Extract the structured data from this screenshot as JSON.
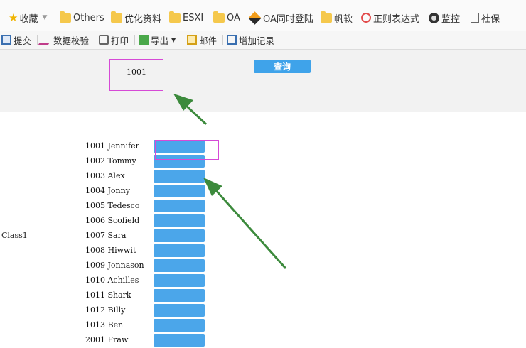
{
  "bookmarks": {
    "favorites": "收藏",
    "items": [
      "Others",
      "优化资料",
      "ESXI",
      "OA",
      "OA同时登陆",
      "帆软",
      "正则表达式",
      "监控",
      "社保"
    ]
  },
  "toolbar": {
    "submit": "提交",
    "validate": "数据校验",
    "print": "打印",
    "export": "导出",
    "mail": "邮件",
    "add_record": "增加记录"
  },
  "query": {
    "input_value": "1001",
    "button_label": "查询"
  },
  "list": {
    "class_label": "Class1",
    "rows": [
      "1001 Jennifer",
      "1002 Tommy",
      "1003 Alex",
      "1004 Jonny",
      "1005 Tedesco",
      "1006 Scofield",
      "1007 Sara",
      "1008 Hiwwit",
      "1009 Jonnason",
      "1010 Achilles",
      "1011 Shark",
      "1012 Billy",
      "1013 Ben",
      "2001 Fraw"
    ]
  },
  "colors": {
    "accent_button": "#4ba6ea",
    "highlight_box": "#d64ad6",
    "arrow": "#3c8a3c"
  }
}
